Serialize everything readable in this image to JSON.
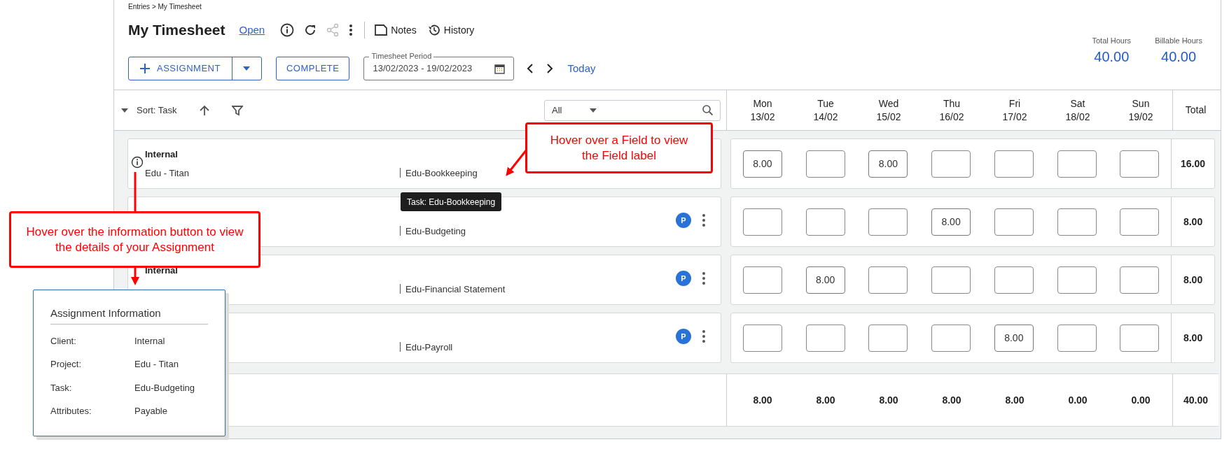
{
  "breadcrumb": "Entries > My Timesheet",
  "title": "My Timesheet",
  "status": "Open",
  "toolbar": [
    {
      "kind": "notes",
      "label": "Notes"
    },
    {
      "kind": "history",
      "label": "History"
    }
  ],
  "assignment_button": "ASSIGNMENT",
  "complete_button": "COMPLETE",
  "period": {
    "label": "Timesheet Period",
    "value": "13/02/2023 - 19/02/2023"
  },
  "today": "Today",
  "summary": [
    {
      "label": "Total Hours",
      "value": "40.00"
    },
    {
      "label": "Billable Hours",
      "value": "40.00"
    }
  ],
  "sort": "Sort: Task",
  "filter": {
    "value": "All"
  },
  "days": [
    {
      "day": "Mon",
      "date": "13/02"
    },
    {
      "day": "Tue",
      "date": "14/02"
    },
    {
      "day": "Wed",
      "date": "15/02"
    },
    {
      "day": "Thu",
      "date": "16/02"
    },
    {
      "day": "Fri",
      "date": "17/02"
    },
    {
      "day": "Sat",
      "date": "18/02"
    },
    {
      "day": "Sun",
      "date": "19/02"
    }
  ],
  "total_label": "Total",
  "rows": [
    {
      "info_icon": true,
      "client": "Internal",
      "project": "Edu - Titan",
      "task": "Edu-Bookkeeping",
      "menu": false,
      "hours": [
        {
          "filled": true,
          "value": "8.00"
        },
        {
          "filled": false
        },
        {
          "filled": true,
          "value": "8.00"
        },
        {
          "filled": false
        },
        {
          "filled": false
        },
        {
          "filled": false
        },
        {
          "filled": false
        }
      ],
      "total": "16.00"
    },
    {
      "info_icon": false,
      "task": "Edu-Budgeting",
      "badge": "P",
      "menu": true,
      "hours": [
        {
          "filled": false
        },
        {
          "filled": false
        },
        {
          "filled": false
        },
        {
          "filled": true,
          "value": "8.00"
        },
        {
          "filled": false
        },
        {
          "filled": false
        },
        {
          "filled": false
        }
      ],
      "total": "8.00"
    },
    {
      "info_icon": false,
      "client": "Internal",
      "task": "Edu-Financial Statement",
      "badge": "P",
      "menu": true,
      "hours": [
        {
          "filled": false
        },
        {
          "filled": true,
          "value": "8.00"
        },
        {
          "filled": false
        },
        {
          "filled": false
        },
        {
          "filled": false
        },
        {
          "filled": false
        },
        {
          "filled": false
        }
      ],
      "total": "8.00"
    },
    {
      "info_icon": false,
      "task": "Edu-Payroll",
      "badge": "P",
      "menu": true,
      "hours": [
        {
          "filled": false
        },
        {
          "filled": false
        },
        {
          "filled": false
        },
        {
          "filled": false
        },
        {
          "filled": true,
          "value": "8.00"
        },
        {
          "filled": false
        },
        {
          "filled": false
        }
      ],
      "total": "8.00"
    }
  ],
  "totals": {
    "days": [
      "8.00",
      "8.00",
      "8.00",
      "8.00",
      "8.00",
      "0.00",
      "0.00"
    ],
    "total": "40.00"
  },
  "tooltip": "Task: Edu-Bookkeeping",
  "callouts": [
    "Hover over a Field to view the Field label",
    "Hover over the information button to view the details of your Assignment"
  ],
  "info_popup": {
    "title": "Assignment Information",
    "fields": [
      {
        "label": "Client:",
        "value": "Internal"
      },
      {
        "label": "Project:",
        "value": "Edu - Titan"
      },
      {
        "label": "Task:",
        "value": "Edu-Budgeting"
      },
      {
        "label": "Attributes:",
        "value": "Payable"
      }
    ]
  }
}
